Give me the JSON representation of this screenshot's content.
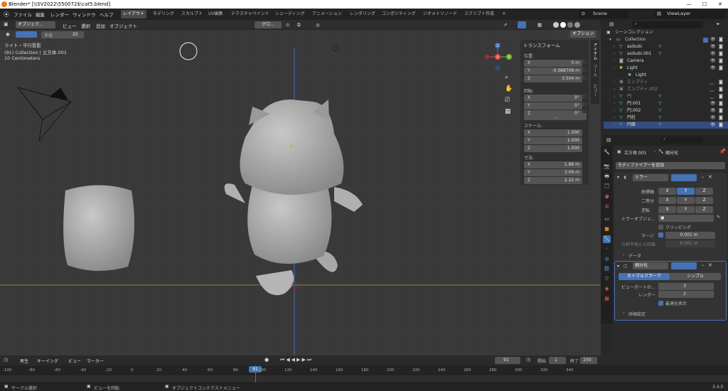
{
  "window": {
    "title": "Blender* [\\\\SV2022\\550072$\\cat5.blend]",
    "minimize": "—",
    "maximize": "☐",
    "close": "✕"
  },
  "menus": [
    "ファイル",
    "編集",
    "レンダー",
    "ウィンドウ",
    "ヘルプ"
  ],
  "workspaces": [
    "レイアウト",
    "モデリング",
    "スカルプト",
    "UV編集",
    "テクスチャペイント",
    "シェーディング",
    "アニメーション",
    "レンダリング",
    "コンポジティング",
    "ジオメトリノード",
    "スクリプト作成"
  ],
  "scene": "Scene",
  "view_layer": "ViewLayer",
  "viewport": {
    "header": {
      "mode": "オブジェク...",
      "menus": [
        "ビュー",
        "選択",
        "追加",
        "オブジェクト"
      ],
      "transform": "グロ...",
      "options": "オプション"
    },
    "tool": {
      "radius_label": "半径",
      "radius_value": "25"
    },
    "overlay": {
      "line1": "ライト・平行投影",
      "line2": "(91) Collection | 立方体.001",
      "line3": "10 Centimeters"
    },
    "gizmo": {
      "x": "X",
      "y": "Y",
      "z": "Z"
    },
    "tabs": [
      "アイテム",
      "ツール",
      "ビュー"
    ]
  },
  "npanel": {
    "title": "トランスフォーム",
    "location_label": "位置:",
    "location": [
      {
        "axis": "X",
        "value": "0 m"
      },
      {
        "axis": "Y",
        "value": "-0.088708 m"
      },
      {
        "axis": "Z",
        "value": "3.504 m"
      }
    ],
    "rotation_label": "回転:",
    "rotation": [
      {
        "axis": "X",
        "value": "0°"
      },
      {
        "axis": "Y",
        "value": "0°"
      },
      {
        "axis": "Z",
        "value": "0°"
      }
    ],
    "rotation_mode": "XYZ オイラー角",
    "scale_label": "スケール:",
    "scale": [
      {
        "axis": "X",
        "value": "1.000"
      },
      {
        "axis": "Y",
        "value": "1.000"
      },
      {
        "axis": "Z",
        "value": "1.000"
      }
    ],
    "dimensions_label": "寸法:",
    "dimensions": [
      {
        "axis": "X",
        "value": "1.88 m"
      },
      {
        "axis": "Y",
        "value": "3.09 m"
      },
      {
        "axis": "Z",
        "value": "2.22 m"
      }
    ]
  },
  "outliner": {
    "root": "シーンコレクション",
    "collection": "Collection",
    "items": [
      {
        "name": "asikubi",
        "icon": "mesh"
      },
      {
        "name": "asikubi.001",
        "icon": "mesh"
      },
      {
        "name": "Camera",
        "icon": "camera"
      },
      {
        "name": "Light",
        "icon": "light"
      },
      {
        "name": "Light",
        "icon": "light-data"
      },
      {
        "name": "エンプティ",
        "icon": "empty"
      },
      {
        "name": "エンプティ.002",
        "icon": "empty"
      },
      {
        "name": "円",
        "icon": "mesh"
      },
      {
        "name": "円.001",
        "icon": "mesh"
      },
      {
        "name": "円.002",
        "icon": "mesh"
      },
      {
        "name": "円柱",
        "icon": "mesh"
      },
      {
        "name": "円錐",
        "icon": "mesh"
      }
    ]
  },
  "properties": {
    "breadcrumb_object": "立方体.001",
    "breadcrumb_modifier": "細分化",
    "add_modifier": "モディファイアーを追加",
    "mirror": {
      "name": "ミラー",
      "axis_label": "座標軸",
      "bisect_label": "二等分",
      "flip_label": "逆転",
      "axes": [
        "X",
        "Y",
        "Z"
      ],
      "mirror_object_label": "ミラーオブジェ...",
      "clipping_label": "クリッピング",
      "merge_label": "マージ",
      "merge_value": "0.001 m",
      "bisect_distance_label": "分割平面との距離",
      "bisect_distance_value": "0.001 m",
      "data_label": "データ"
    },
    "subsurf": {
      "name": "細分化",
      "tab_catmull": "カトマルクラーク",
      "tab_simple": "シンプル",
      "viewport_label": "ビューポートの...",
      "viewport_value": "3",
      "render_label": "レンダー",
      "render_value": "2",
      "optimal_label": "最適化表示",
      "advanced_label": "詳細設定"
    }
  },
  "timeline": {
    "playback": "再生",
    "keying": "キーイング",
    "view": "ビュー",
    "marker": "マーカー",
    "current_frame": "91",
    "start_label": "開始",
    "start": "1",
    "end_label": "終了",
    "end": "250",
    "ticks": [
      "-100",
      "-80",
      "-60",
      "-40",
      "-20",
      "0",
      "20",
      "40",
      "60",
      "80",
      "100",
      "120",
      "140",
      "160",
      "180",
      "200",
      "220",
      "240",
      "260",
      "280",
      "300",
      "320",
      "340"
    ]
  },
  "status": {
    "select": "サークル選択",
    "rotate": "ビューを回転",
    "context": "オブジェクトコンテクストメニュー",
    "version": "3.4.0"
  },
  "colors": {
    "accent": "#4772b3",
    "x_axis": "#e04646",
    "y_axis": "#77b62f",
    "z_axis": "#3b6ec2",
    "mesh_icon": "#5fd1b4"
  }
}
